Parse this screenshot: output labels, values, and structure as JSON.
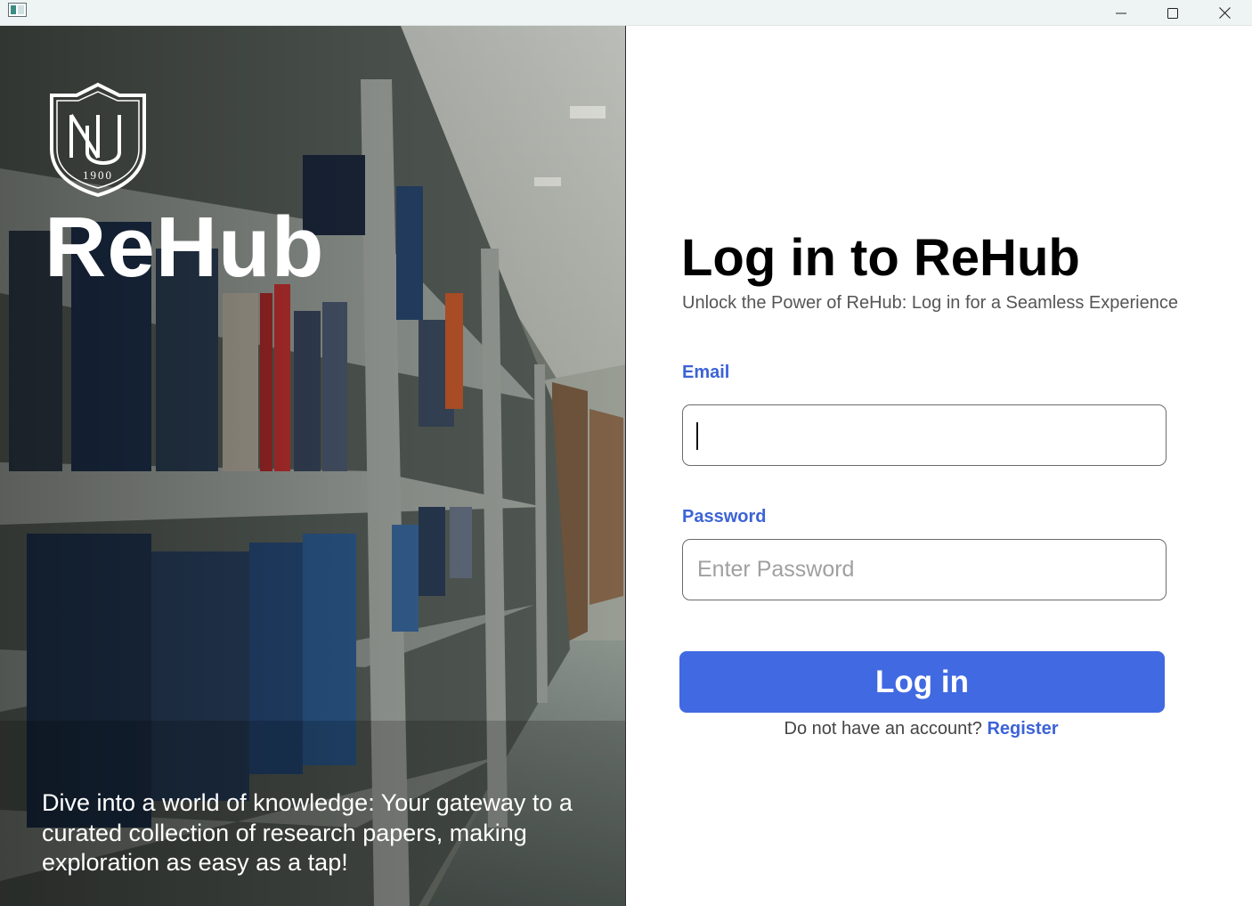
{
  "window": {
    "icon": "app-window-icon",
    "controls": {
      "minimize_icon": "minimize-icon",
      "maximize_icon": "maximize-icon",
      "close_icon": "close-icon"
    }
  },
  "hero": {
    "crest": {
      "monogram": "NU",
      "year": "1900"
    },
    "brand": "ReHub",
    "tagline": "Dive into a world of knowledge: Your gateway to a curated collection of research papers, making exploration as easy as a tap!"
  },
  "login": {
    "title": "Log in to ReHub",
    "subtitle": "Unlock the Power of ReHub: Log in for a Seamless Experience",
    "email": {
      "label": "Email",
      "value": "",
      "placeholder": ""
    },
    "password": {
      "label": "Password",
      "value": "",
      "placeholder": "Enter Password"
    },
    "submit_label": "Log in",
    "register_prompt": "Do not have an account?",
    "register_link": "Register"
  },
  "colors": {
    "accent": "#4169e1",
    "label_blue": "#3c63d6",
    "titlebar": "#eef4f3"
  }
}
